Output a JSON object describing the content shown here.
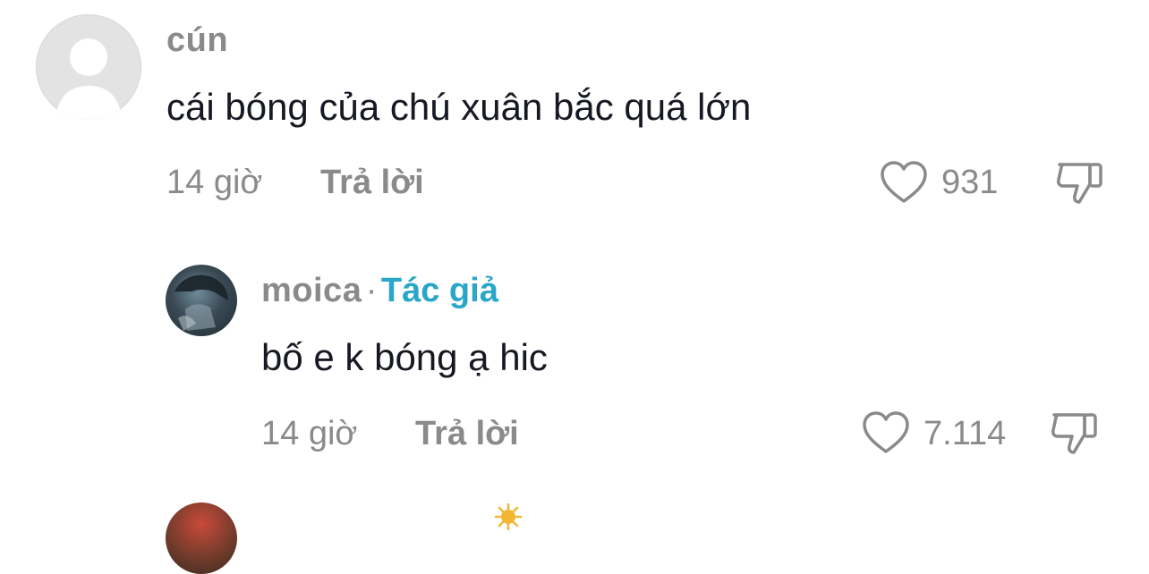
{
  "comments": [
    {
      "username": "cún",
      "text": "cái bóng của chú xuân bắc quá lớn",
      "time": "14 giờ",
      "reply_label": "Trả lời",
      "likes": "931",
      "avatar_icon": "default-avatar-icon"
    },
    {
      "username": "moica",
      "separator": "·",
      "badge": "Tác giả",
      "text": "bố e k bóng ạ hic",
      "time": "14 giờ",
      "reply_label": "Trả lời",
      "likes": "7.114",
      "avatar_icon": "photo-avatar"
    }
  ],
  "icons": {
    "like": "heart-outline-icon",
    "dislike": "thumbs-down-icon"
  },
  "colors": {
    "badge": "#2aa6c8",
    "muted": "#8a8a8a",
    "text": "#161823"
  }
}
